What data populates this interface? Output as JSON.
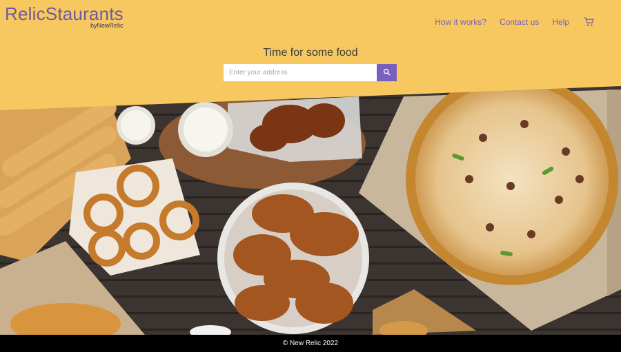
{
  "brand": {
    "title": "RelicStaurants",
    "subtitle": "byNewRelic"
  },
  "nav": {
    "how_label": "How it works?",
    "contact_label": "Contact us",
    "help_label": "Help",
    "cart_icon": "cart-icon"
  },
  "hero": {
    "heading": "Time for some food",
    "search_placeholder": "Enter your address",
    "search_value": "",
    "search_icon": "search-icon"
  },
  "footer": {
    "text": "© New Relic 2022"
  },
  "colors": {
    "header_bg": "#f6c85f",
    "accent": "#7a5fc0",
    "footer_bg": "#000000"
  }
}
